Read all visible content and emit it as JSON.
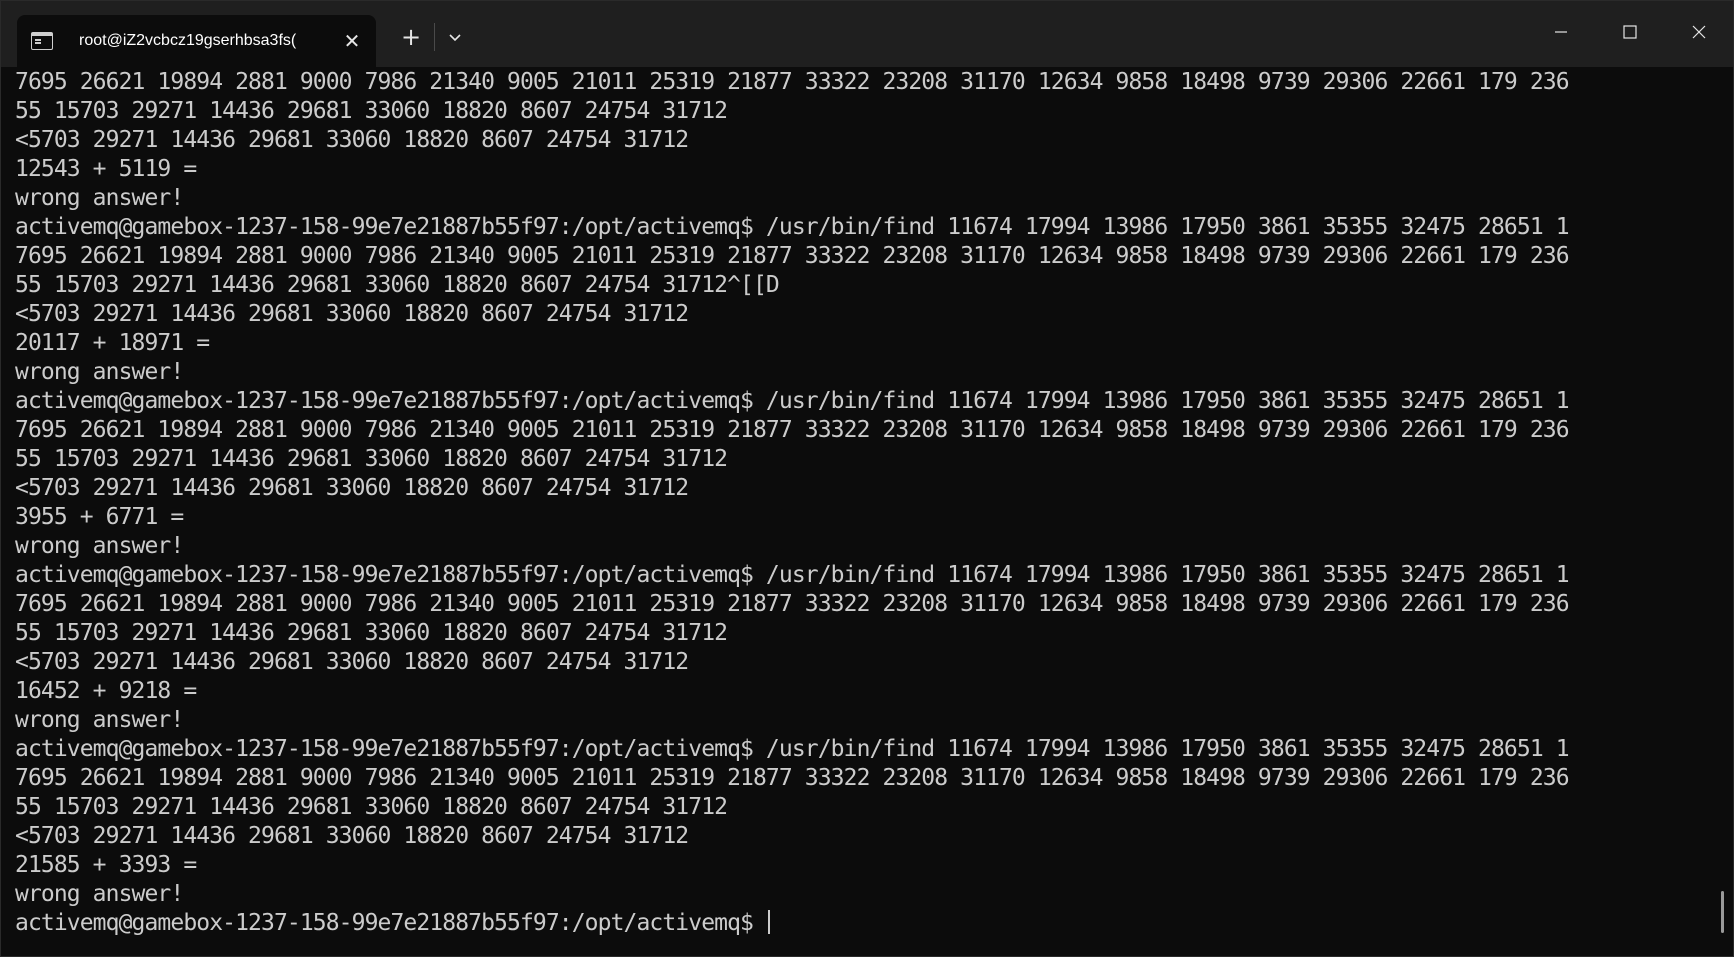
{
  "window": {
    "tab_title": "root@iZ2vcbcz19gserhbsa3fs(",
    "tab_close_glyph": "✕",
    "new_tab_glyph": "+"
  },
  "terminal": {
    "lines": [
      "7695 26621 19894 2881 9000 7986 21340 9005 21011 25319 21877 33322 23208 31170 12634 9858 18498 9739 29306 22661 179 236",
      "55 15703 29271 14436 29681 33060 18820 8607 24754 31712",
      "<5703 29271 14436 29681 33060 18820 8607 24754 31712",
      "12543 + 5119 =",
      "wrong answer!",
      "activemq@gamebox-1237-158-99e7e21887b55f97:/opt/activemq$ /usr/bin/find 11674 17994 13986 17950 3861 35355 32475 28651 1",
      "7695 26621 19894 2881 9000 7986 21340 9005 21011 25319 21877 33322 23208 31170 12634 9858 18498 9739 29306 22661 179 236",
      "55 15703 29271 14436 29681 33060 18820 8607 24754 31712^[[D",
      "<5703 29271 14436 29681 33060 18820 8607 24754 31712",
      "20117 + 18971 =",
      "wrong answer!",
      "activemq@gamebox-1237-158-99e7e21887b55f97:/opt/activemq$ /usr/bin/find 11674 17994 13986 17950 3861 35355 32475 28651 1",
      "7695 26621 19894 2881 9000 7986 21340 9005 21011 25319 21877 33322 23208 31170 12634 9858 18498 9739 29306 22661 179 236",
      "55 15703 29271 14436 29681 33060 18820 8607 24754 31712",
      "<5703 29271 14436 29681 33060 18820 8607 24754 31712",
      "3955 + 6771 =",
      "wrong answer!",
      "activemq@gamebox-1237-158-99e7e21887b55f97:/opt/activemq$ /usr/bin/find 11674 17994 13986 17950 3861 35355 32475 28651 1",
      "7695 26621 19894 2881 9000 7986 21340 9005 21011 25319 21877 33322 23208 31170 12634 9858 18498 9739 29306 22661 179 236",
      "55 15703 29271 14436 29681 33060 18820 8607 24754 31712",
      "<5703 29271 14436 29681 33060 18820 8607 24754 31712",
      "16452 + 9218 =",
      "wrong answer!",
      "activemq@gamebox-1237-158-99e7e21887b55f97:/opt/activemq$ /usr/bin/find 11674 17994 13986 17950 3861 35355 32475 28651 1",
      "7695 26621 19894 2881 9000 7986 21340 9005 21011 25319 21877 33322 23208 31170 12634 9858 18498 9739 29306 22661 179 236",
      "55 15703 29271 14436 29681 33060 18820 8607 24754 31712",
      "<5703 29271 14436 29681 33060 18820 8607 24754 31712",
      "21585 + 3393 =",
      "wrong answer!"
    ],
    "prompt": "activemq@gamebox-1237-158-99e7e21887b55f97:/opt/activemq$ "
  },
  "icons": {
    "terminal": "terminal-icon",
    "dropdown": "chevron-down-icon",
    "minimize": "minimize-icon",
    "maximize": "maximize-icon",
    "close": "close-icon"
  },
  "colors": {
    "background": "#0c0c0c",
    "titlebar": "#1f1f1f",
    "text": "#cccccc"
  }
}
